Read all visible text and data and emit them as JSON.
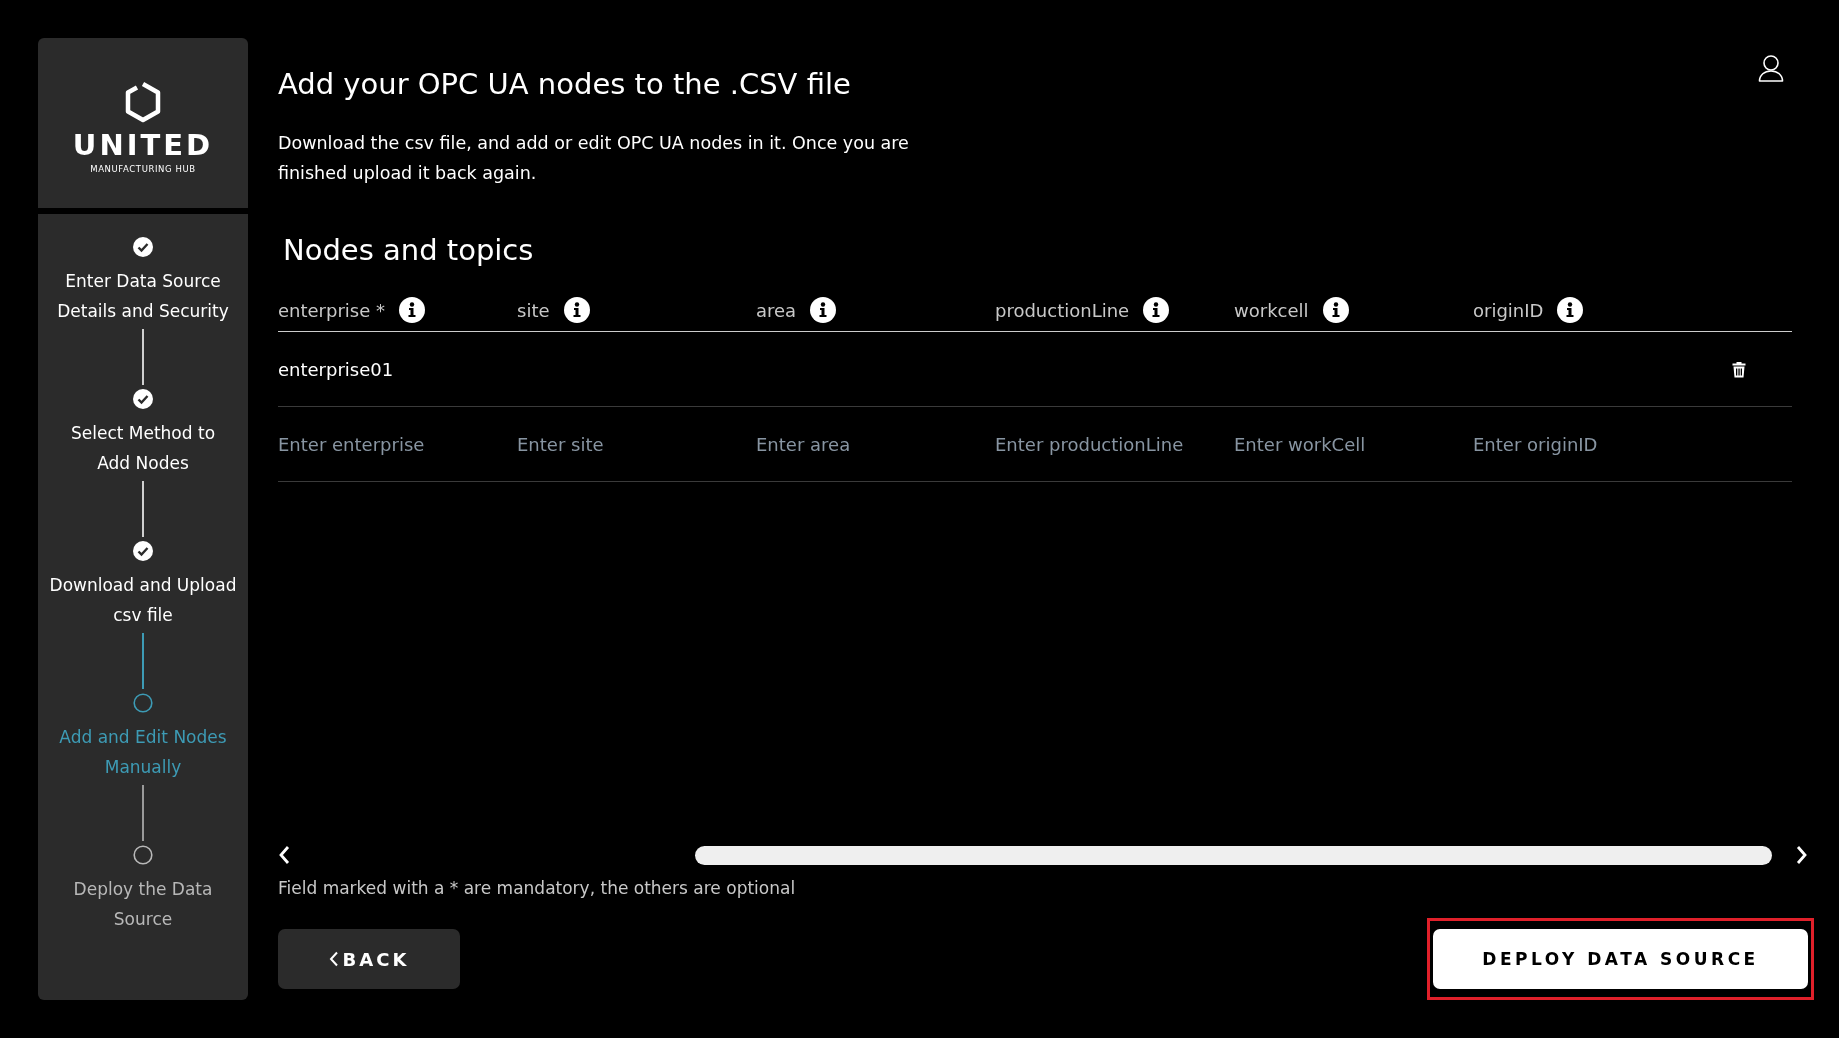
{
  "logo": {
    "title": "UNITED",
    "subtitle": "MANUFACTURING HUB"
  },
  "steps": [
    {
      "label": "Enter Data Source Details and Security",
      "done": true,
      "selected": false
    },
    {
      "label": "Select Method to Add Nodes",
      "done": true,
      "selected": false
    },
    {
      "label": "Download and Upload csv file",
      "done": true,
      "selected": false
    },
    {
      "label": "Add and Edit Nodes Manually",
      "done": false,
      "selected": true
    },
    {
      "label": "Deploy the Data Source",
      "done": false,
      "selected": false
    }
  ],
  "page": {
    "title": "Add your OPC UA nodes to the .CSV file",
    "description": "Download the csv file, and add or edit OPC UA nodes in it. Once you are finished upload it back again."
  },
  "table": {
    "title": "Nodes and topics",
    "columns": [
      "enterprise *",
      "site",
      "area",
      "productionLine",
      "workcell",
      "originID"
    ],
    "rows": [
      {
        "deletable": true,
        "cells": [
          {
            "value": "enterprise01"
          },
          {},
          {},
          {},
          {},
          {}
        ]
      },
      {
        "deletable": false,
        "cells": [
          {
            "placeholder": "Enter enterprise"
          },
          {
            "placeholder": "Enter site"
          },
          {
            "placeholder": "Enter area"
          },
          {
            "placeholder": "Enter productionLine"
          },
          {
            "placeholder": "Enter workCell"
          },
          {
            "placeholder": "Enter originID"
          }
        ]
      }
    ]
  },
  "footnote": "Field marked with a * are mandatory, the others are optional",
  "buttons": {
    "back": "BACK",
    "deploy": "DEPLOY DATA SOURCE"
  }
}
